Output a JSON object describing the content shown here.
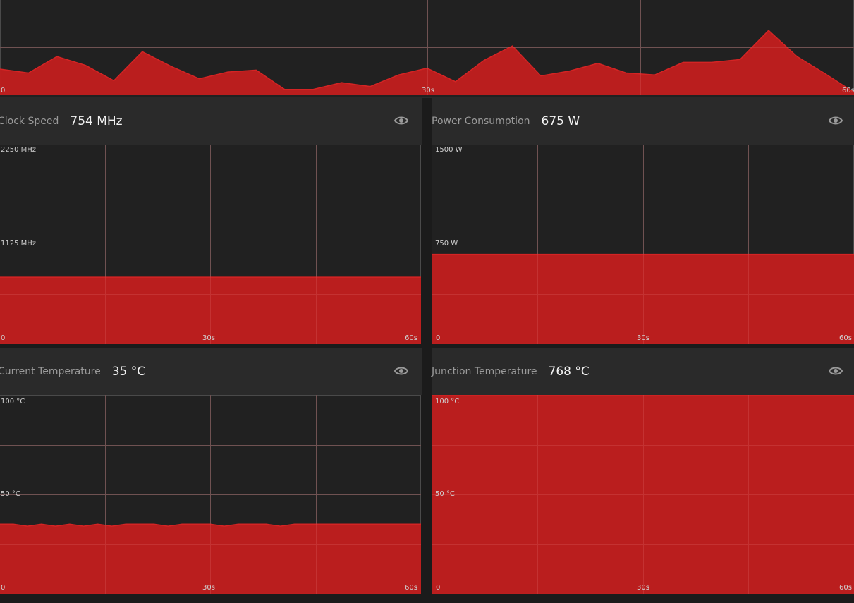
{
  "colors": {
    "fill": "#bf1e1e",
    "stroke": "#d42424",
    "grid": "#4a4a4a",
    "chart_bg": "#212121",
    "header_bg": "#2a2a2a"
  },
  "top_chart": {
    "x_labels": [
      "0",
      "30s",
      "60s"
    ]
  },
  "panels": {
    "clock_speed": {
      "title": "Clock Speed",
      "value": "754 MHz",
      "icon": "eye-icon",
      "y_labels": [
        "2250 MHz",
        "1125 MHz",
        "0"
      ],
      "x_labels": [
        "30s",
        "60s"
      ]
    },
    "power": {
      "title": "Power Consumption",
      "value": "675 W",
      "icon": "eye-icon",
      "y_labels": [
        "1500 W",
        "750 W",
        "0"
      ],
      "x_labels": [
        "30s",
        "60s"
      ]
    },
    "current_temp": {
      "title": "Current Temperature",
      "value": "35 °C",
      "icon": "eye-icon",
      "y_labels": [
        "100 °C",
        "50 °C",
        "0"
      ],
      "x_labels": [
        "30s",
        "60s"
      ]
    },
    "junction_temp": {
      "title": "Junction Temperature",
      "value": "768 °C",
      "icon": "eye-icon",
      "y_labels": [
        "100 °C",
        "50 °C",
        "0"
      ],
      "x_labels": [
        "30s",
        "60s"
      ]
    }
  },
  "chart_data": [
    {
      "type": "area",
      "title": "",
      "x": [
        0,
        2,
        4,
        6,
        8,
        10,
        12,
        14,
        16,
        18,
        20,
        22,
        24,
        26,
        28,
        30,
        32,
        34,
        36,
        38,
        40,
        42,
        44,
        46,
        48,
        50,
        52,
        54,
        56,
        58,
        60
      ],
      "series": [
        {
          "values": [
            27,
            23,
            40,
            31,
            15,
            45,
            30,
            17,
            24,
            26,
            6,
            6,
            13,
            9,
            21,
            28,
            14,
            36,
            51,
            20,
            25,
            33,
            23,
            21,
            34,
            34,
            37,
            67,
            40,
            22,
            3
          ]
        }
      ],
      "xlim": [
        0,
        60
      ],
      "ylim": [
        0,
        100
      ]
    },
    {
      "type": "area",
      "title": "Clock Speed",
      "ylabel": "MHz",
      "x": [
        0,
        60
      ],
      "series": [
        {
          "values": [
            754,
            754
          ]
        }
      ],
      "xlim": [
        0,
        60
      ],
      "ylim": [
        0,
        2250
      ]
    },
    {
      "type": "area",
      "title": "Power Consumption",
      "ylabel": "W",
      "x": [
        0,
        60
      ],
      "series": [
        {
          "values": [
            675,
            675
          ]
        }
      ],
      "xlim": [
        0,
        60
      ],
      "ylim": [
        0,
        1500
      ]
    },
    {
      "type": "area",
      "title": "Current Temperature",
      "ylabel": "°C",
      "x": [
        0,
        2,
        4,
        6,
        8,
        10,
        12,
        14,
        16,
        18,
        20,
        22,
        24,
        26,
        28,
        30,
        32,
        34,
        36,
        38,
        40,
        42,
        44,
        46,
        48,
        50,
        52,
        54,
        56,
        58,
        60
      ],
      "series": [
        {
          "values": [
            35,
            35,
            34,
            35,
            34,
            35,
            34,
            35,
            34,
            35,
            35,
            35,
            34,
            35,
            35,
            35,
            34,
            35,
            35,
            35,
            34,
            35,
            35,
            35,
            35,
            35,
            35,
            35,
            35,
            35,
            35
          ]
        }
      ],
      "xlim": [
        0,
        60
      ],
      "ylim": [
        0,
        100
      ]
    },
    {
      "type": "area",
      "title": "Junction Temperature",
      "ylabel": "°C",
      "x": [
        0,
        60
      ],
      "series": [
        {
          "values": [
            100,
            100
          ]
        }
      ],
      "xlim": [
        0,
        60
      ],
      "ylim": [
        0,
        100
      ]
    }
  ]
}
